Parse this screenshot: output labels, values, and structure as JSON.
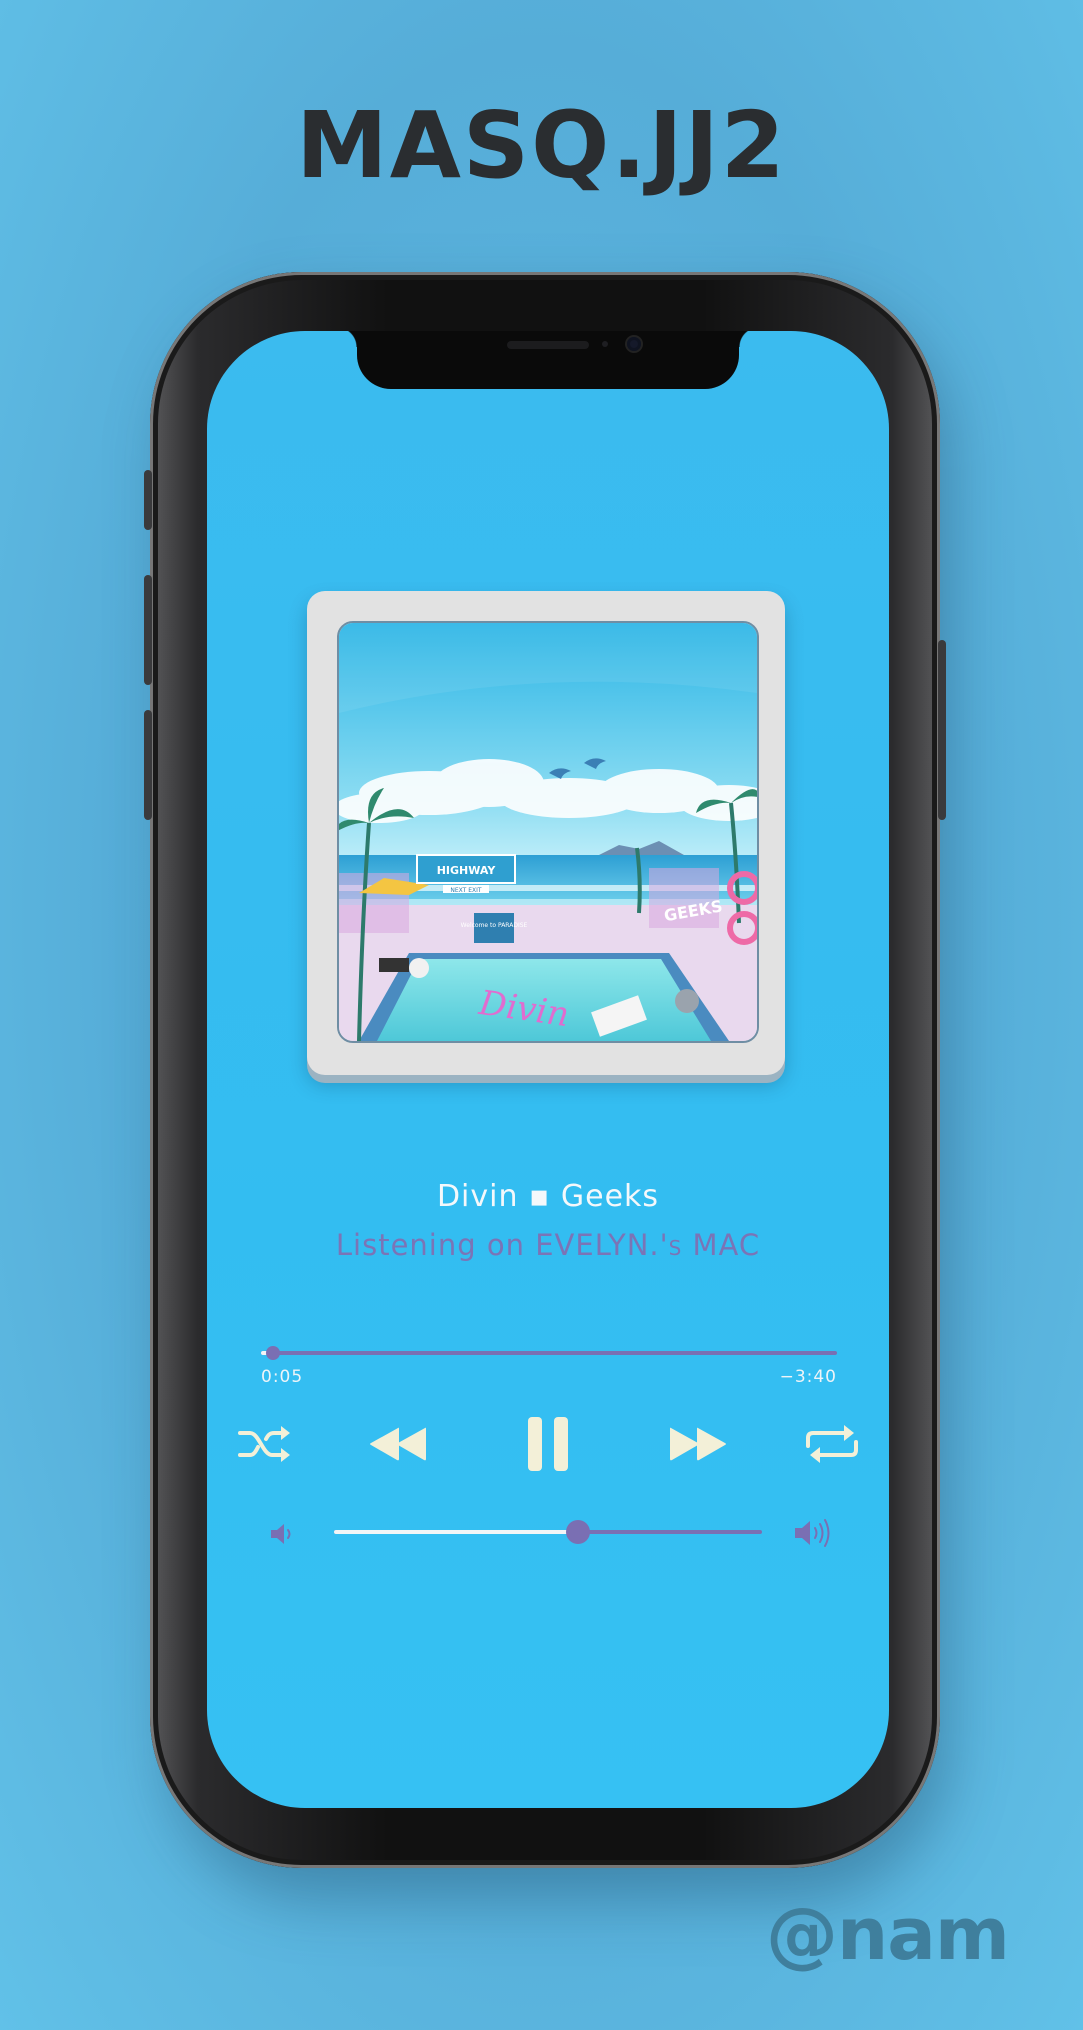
{
  "poster": {
    "title": "MASQ.JJ2",
    "watermark": "@nam"
  },
  "player": {
    "track_title": "Divin ▪ Geeks",
    "device_prefix": "Listening on ",
    "device_name": "EVELYN.'s MAC",
    "elapsed": "0:05",
    "remaining": "−3:40",
    "progress_fraction": 0.02,
    "volume_fraction": 0.57,
    "is_playing": true
  },
  "album_art_signs": {
    "highway": "HIGHWAY",
    "next_exit": "NEXT EXIT",
    "welcome": "Welcome to PARADISE",
    "geeks": "GEEKS",
    "divin": "Divin"
  },
  "icons": {
    "shuffle": "shuffle-icon",
    "rewind": "rewind-icon",
    "pause": "pause-icon",
    "fast_forward": "fast-forward-icon",
    "repeat": "repeat-icon",
    "volume_low": "volume-low-icon",
    "volume_high": "volume-high-icon"
  },
  "colors": {
    "background": "#5cb6e0",
    "screen": "#35bdf1",
    "accent": "#7a6fb3",
    "controls": "#f3f0d8"
  }
}
